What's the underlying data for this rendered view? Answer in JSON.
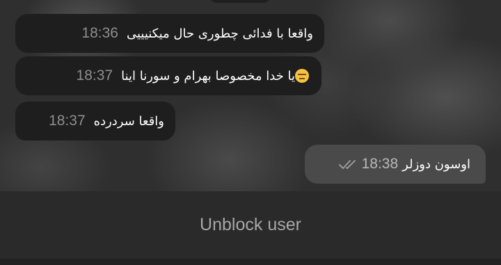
{
  "messages": [
    {
      "text": "واقعا با فدائی چطوری حال میکنیییی",
      "time": "18:36",
      "direction": "incoming"
    },
    {
      "text": "یا خدا مخصوصا بهرام و سورنا اینا",
      "time": "18:37",
      "direction": "incoming",
      "emoji": "expressionless-face-icon"
    },
    {
      "text": "واقعا سردرده",
      "time": "18:37",
      "direction": "incoming"
    },
    {
      "text": "اوسون دوزلر",
      "time": "18:38",
      "direction": "outgoing",
      "status": "read-double-check-icon"
    }
  ],
  "footer": {
    "unblock_label": "Unblock user"
  },
  "colors": {
    "incoming_bubble": "#1e1e1e",
    "outgoing_bubble": "#4a4a4a",
    "footer_bg": "#2a2a2a",
    "unblock_text": "#a7a7a7"
  }
}
